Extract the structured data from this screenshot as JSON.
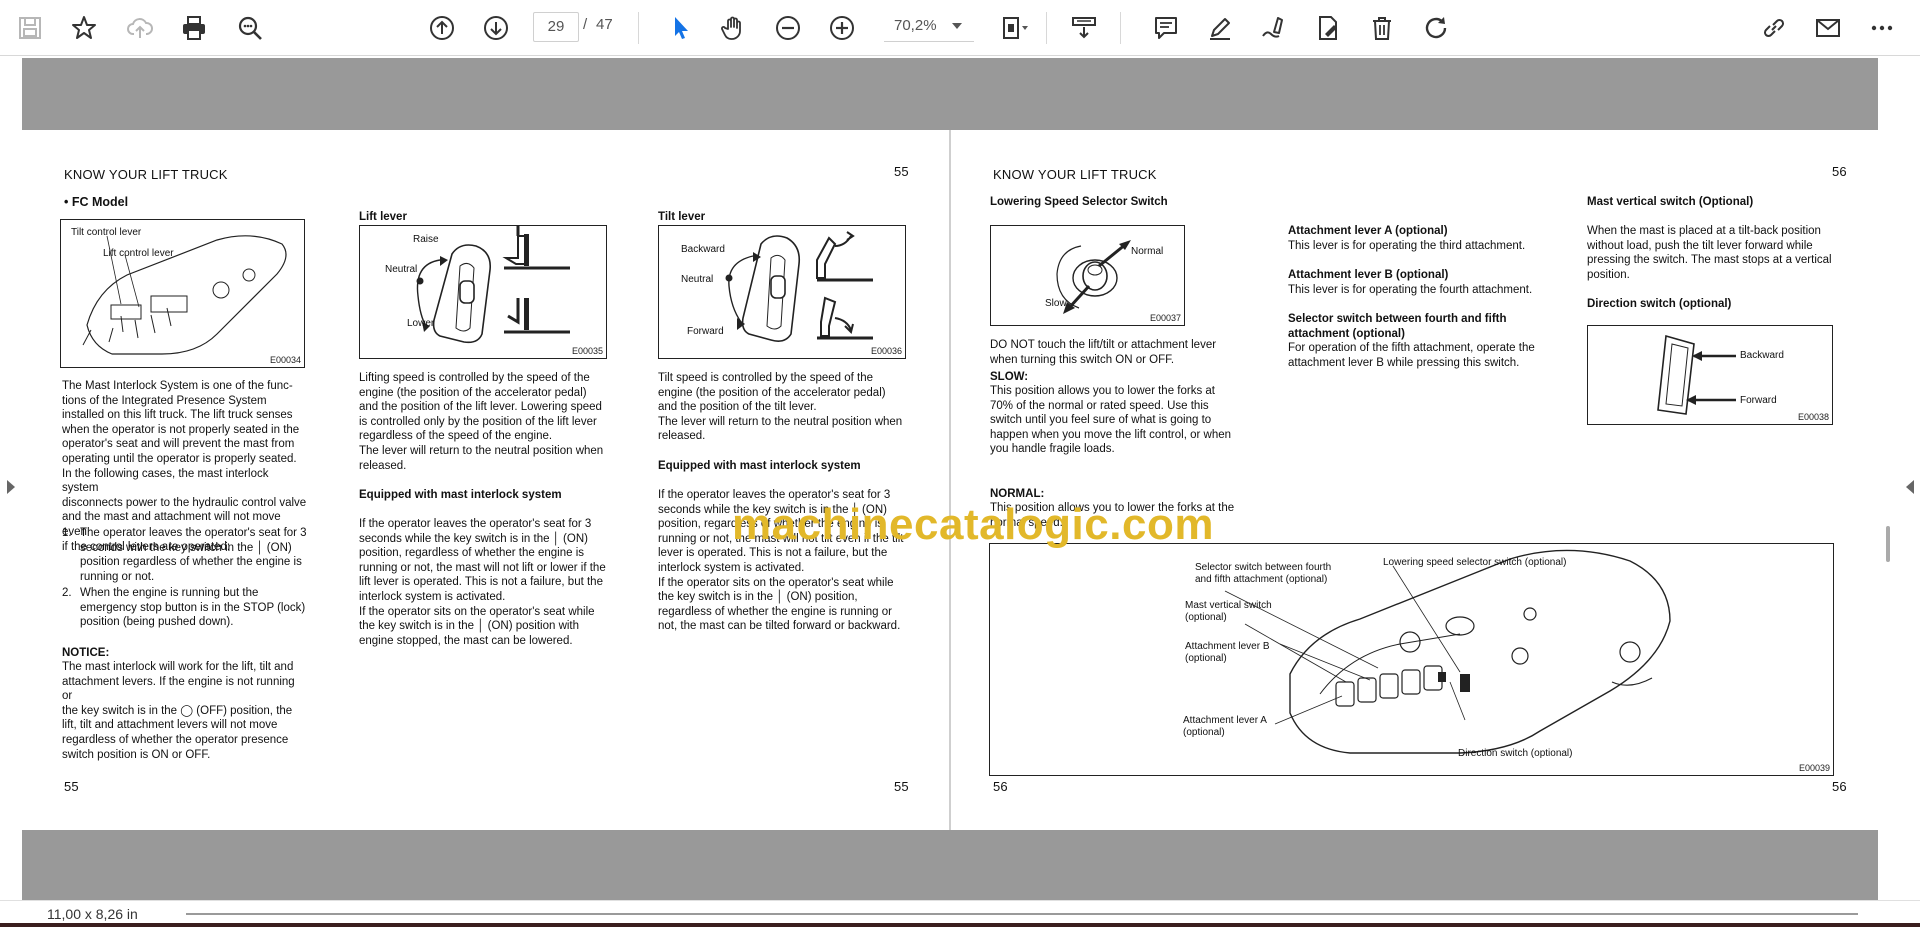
{
  "toolbar": {
    "page_current": "29",
    "page_separator": "/",
    "page_total": "47",
    "zoom_value": "70,2%",
    "icons": [
      "save-icon",
      "bookmark-star-icon",
      "cloud-upload-icon",
      "print-icon",
      "search-zoom-icon",
      "previous-page-icon",
      "next-page-icon",
      "select-cursor-icon",
      "hand-tool-icon",
      "zoom-out-icon",
      "zoom-in-icon",
      "page-fit-icon",
      "scroll-mode-icon",
      "comment-icon",
      "highlight-pen-icon",
      "draw-icon",
      "fill-sign-icon",
      "delete-icon",
      "rotate-icon",
      "share-link-icon",
      "email-icon",
      "more-icon"
    ]
  },
  "status": {
    "page_size": "11,00 x 8,26 in"
  },
  "watermark": "machinecatalogic.com",
  "left_page": {
    "header": "KNOW YOUR LIFT TRUCK",
    "page_no_top": "55",
    "page_no_bottom_left": "55",
    "page_no_bottom_right": "55",
    "col1": {
      "title": "• FC Model",
      "fig_labels": [
        "Tilt control lever",
        "Lift control lever"
      ],
      "fig_code": "E00034",
      "para1": "The Mast Interlock System is one of the func-\ntions of the Integrated Presence System\ninstalled on this lift truck. The lift truck senses\nwhen the operator is not properly seated in the\noperator's seat and will prevent the mast from\noperating until the operator is properly seated.\nIn the following cases, the mast interlock system\ndisconnects power to the hydraulic control valve\nand the mast and attachment will not move even\nif the control levers are operated:",
      "list": [
        {
          "num": "1.",
          "text": "The operator leaves the operator's seat for 3\nseconds with the key switch in the  │  (ON)\nposition regardless of whether the engine is\nrunning or not."
        },
        {
          "num": "2.",
          "text": "When the engine is running but the\nemergency stop button is in the STOP (lock)\nposition (being pushed down)."
        }
      ],
      "notice_title": "NOTICE:",
      "notice_text": "The mast interlock will work for the lift, tilt and\nattachment levers. If the engine is not running or\nthe key switch is in the ◯ (OFF) position, the\nlift, tilt and attachment levers will not move\nregardless of whether the operator presence\nswitch position is ON or OFF."
    },
    "col2": {
      "title": "Lift lever",
      "fig_labels": [
        "Raise",
        "Neutral",
        "Lower"
      ],
      "fig_code": "E00035",
      "para1": "Lifting speed is controlled by the speed of the\nengine (the position of the accelerator pedal)\nand the position of the lift lever. Lowering speed\nis controlled only by the position of the lift lever\nregardless of the speed of the engine.\nThe lever will return to the neutral position when\nreleased.",
      "sub_title": "Equipped with mast interlock system",
      "para2": "If the operator leaves the operator's seat for 3\nseconds while the key switch is in the  │  (ON)\nposition, regardless of whether the engine is\nrunning or not, the mast will not lift or lower if the\nlift lever is operated. This is not a failure, but the\ninterlock system is activated.\nIf the operator sits on the operator's seat while\nthe key switch is in the  │  (ON) position with\nengine stopped, the mast can be lowered."
    },
    "col3": {
      "title": "Tilt lever",
      "fig_labels": [
        "Backward",
        "Neutral",
        "Forward"
      ],
      "fig_code": "E00036",
      "para1": "Tilt speed is controlled by the speed of the\nengine (the position of the accelerator pedal)\nand the position of the tilt lever.\nThe lever will return to the neutral position when\nreleased.",
      "sub_title": "Equipped with mast interlock system",
      "para2": "If the operator leaves the operator's seat for 3\nseconds while the key switch is in the  │  (ON)\nposition, regardless of whether the engine is\nrunning or not, the mast will not tilt even if the tilt\nlever is operated. This is not a failure, but the\ninterlock system is activated.\nIf the operator sits on the operator's seat while\nthe key switch is in the  │  (ON) position,\nregardless of whether the engine is running or\nnot, the mast can be tilted forward or backward."
    }
  },
  "right_page": {
    "header": "KNOW YOUR LIFT TRUCK",
    "page_no_top": "56",
    "page_no_bottom_left": "56",
    "page_no_bottom_right": "56",
    "col1": {
      "title": "Lowering Speed Selector Switch",
      "fig_labels": [
        "Normal",
        "Slow"
      ],
      "fig_code": "E00037",
      "para1": "DO NOT touch the lift/tilt or attachment lever\nwhen turning this switch ON or OFF.",
      "slow_title": "SLOW:",
      "slow_text": "This position allows you to lower the forks at\n70% of the normal or rated speed. Use this\nswitch until you feel sure of what is going to\nhappen when you move the lift control, or when\nyou handle fragile loads.",
      "normal_title": "NORMAL:",
      "normal_text": "This position allows you to lower the forks at the\nnormal speed."
    },
    "col2": {
      "a_title": "Attachment lever A (optional)",
      "a_text": "This lever is for operating the third attachment.",
      "b_title": "Attachment lever B (optional)",
      "b_text": "This lever is for operating the fourth attachment.",
      "sel_title": "Selector switch between fourth and fifth\nattachment (optional)",
      "sel_text": "For operation of the fifth attachment, operate the\nattachment lever B while pressing this switch."
    },
    "col3": {
      "mast_title": "Mast vertical switch (Optional)",
      "mast_text": "When the mast is placed at a tilt-back position\nwithout load, push the tilt lever forward while\npressing the switch. The mast stops at a vertical\nposition.",
      "dir_title": "Direction switch (optional)",
      "fig_labels": [
        "Backward",
        "Forward"
      ],
      "fig_code": "E00038"
    },
    "big_fig": {
      "labels": [
        "Selector switch between fourth\nand fifth attachment (optional)",
        "Lowering speed selector switch (optional)",
        "Mast vertical switch\n(optional)",
        "Attachment lever B\n(optional)",
        "Attachment lever A\n(optional)",
        "Direction switch (optional)"
      ],
      "fig_code": "E00039"
    }
  }
}
